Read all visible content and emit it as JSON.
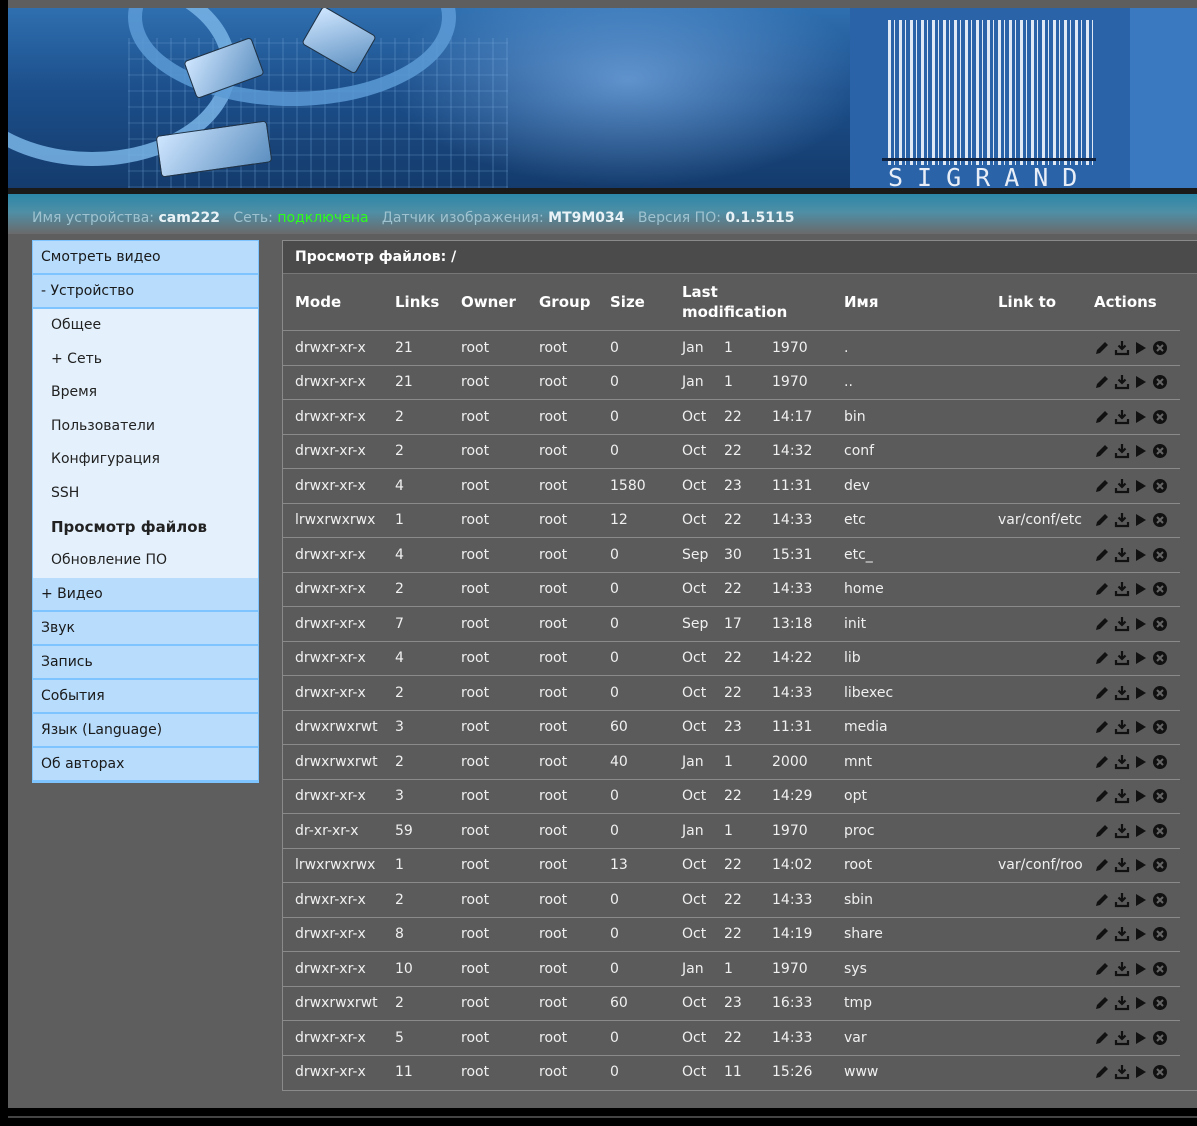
{
  "header": {
    "logo_text": "SIGRAND"
  },
  "status": {
    "device_label": "Имя устройства:",
    "device_value": "cam222",
    "network_label": "Сеть:",
    "network_value": "подключена",
    "sensor_label": "Датчик изображения:",
    "sensor_value": "MT9M034",
    "version_label": "Версия ПО:",
    "version_value": "0.1.5115",
    "network_color": "#2bff1a"
  },
  "menu": {
    "items_top": [
      {
        "label": "Смотреть видео"
      },
      {
        "label": "- Устройство"
      }
    ],
    "sub_items": [
      {
        "label": "Общее"
      },
      {
        "label": "+ Сеть"
      },
      {
        "label": "Время"
      },
      {
        "label": "Пользователи"
      },
      {
        "label": "Конфигурация"
      },
      {
        "label": "SSH"
      },
      {
        "label": "Просмотр файлов",
        "active": true
      },
      {
        "label": "Обновление ПО"
      }
    ],
    "items_bottom": [
      {
        "label": "+ Видео"
      },
      {
        "label": "Звук"
      },
      {
        "label": "Запись"
      },
      {
        "label": "События"
      },
      {
        "label": "Язык (Language)"
      },
      {
        "label": "Об авторах"
      }
    ]
  },
  "panel": {
    "title": "Просмотр файлов: /",
    "columns": [
      "Mode",
      "Links",
      "Owner",
      "Group",
      "Size",
      "Last modification",
      "Имя",
      "Link to",
      "Actions"
    ],
    "action_icons": [
      "edit-icon",
      "download-icon",
      "play-icon",
      "delete-icon"
    ],
    "rows": [
      [
        "drwxr-xr-x",
        "21",
        "root",
        "root",
        "0",
        "Jan",
        "1",
        "1970",
        ".",
        ""
      ],
      [
        "drwxr-xr-x",
        "21",
        "root",
        "root",
        "0",
        "Jan",
        "1",
        "1970",
        "..",
        ""
      ],
      [
        "drwxr-xr-x",
        "2",
        "root",
        "root",
        "0",
        "Oct",
        "22",
        "14:17",
        "bin",
        ""
      ],
      [
        "drwxr-xr-x",
        "2",
        "root",
        "root",
        "0",
        "Oct",
        "22",
        "14:32",
        "conf",
        ""
      ],
      [
        "drwxr-xr-x",
        "4",
        "root",
        "root",
        "1580",
        "Oct",
        "23",
        "11:31",
        "dev",
        ""
      ],
      [
        "lrwxrwxrwx",
        "1",
        "root",
        "root",
        "12",
        "Oct",
        "22",
        "14:33",
        "etc",
        "var/conf/etc"
      ],
      [
        "drwxr-xr-x",
        "4",
        "root",
        "root",
        "0",
        "Sep",
        "30",
        "15:31",
        "etc_",
        ""
      ],
      [
        "drwxr-xr-x",
        "2",
        "root",
        "root",
        "0",
        "Oct",
        "22",
        "14:33",
        "home",
        ""
      ],
      [
        "drwxr-xr-x",
        "7",
        "root",
        "root",
        "0",
        "Sep",
        "17",
        "13:18",
        "init",
        ""
      ],
      [
        "drwxr-xr-x",
        "4",
        "root",
        "root",
        "0",
        "Oct",
        "22",
        "14:22",
        "lib",
        ""
      ],
      [
        "drwxr-xr-x",
        "2",
        "root",
        "root",
        "0",
        "Oct",
        "22",
        "14:33",
        "libexec",
        ""
      ],
      [
        "drwxrwxrwt",
        "3",
        "root",
        "root",
        "60",
        "Oct",
        "23",
        "11:31",
        "media",
        ""
      ],
      [
        "drwxrwxrwt",
        "2",
        "root",
        "root",
        "40",
        "Jan",
        "1",
        "2000",
        "mnt",
        ""
      ],
      [
        "drwxr-xr-x",
        "3",
        "root",
        "root",
        "0",
        "Oct",
        "22",
        "14:29",
        "opt",
        ""
      ],
      [
        "dr-xr-xr-x",
        "59",
        "root",
        "root",
        "0",
        "Jan",
        "1",
        "1970",
        "proc",
        ""
      ],
      [
        "lrwxrwxrwx",
        "1",
        "root",
        "root",
        "13",
        "Oct",
        "22",
        "14:02",
        "root",
        "var/conf/root"
      ],
      [
        "drwxr-xr-x",
        "2",
        "root",
        "root",
        "0",
        "Oct",
        "22",
        "14:33",
        "sbin",
        ""
      ],
      [
        "drwxr-xr-x",
        "8",
        "root",
        "root",
        "0",
        "Oct",
        "22",
        "14:19",
        "share",
        ""
      ],
      [
        "drwxr-xr-x",
        "10",
        "root",
        "root",
        "0",
        "Jan",
        "1",
        "1970",
        "sys",
        ""
      ],
      [
        "drwxrwxrwt",
        "2",
        "root",
        "root",
        "60",
        "Oct",
        "23",
        "16:33",
        "tmp",
        ""
      ],
      [
        "drwxr-xr-x",
        "5",
        "root",
        "root",
        "0",
        "Oct",
        "22",
        "14:33",
        "var",
        ""
      ],
      [
        "drwxr-xr-x",
        "11",
        "root",
        "root",
        "0",
        "Oct",
        "11",
        "15:26",
        "www",
        ""
      ]
    ]
  }
}
